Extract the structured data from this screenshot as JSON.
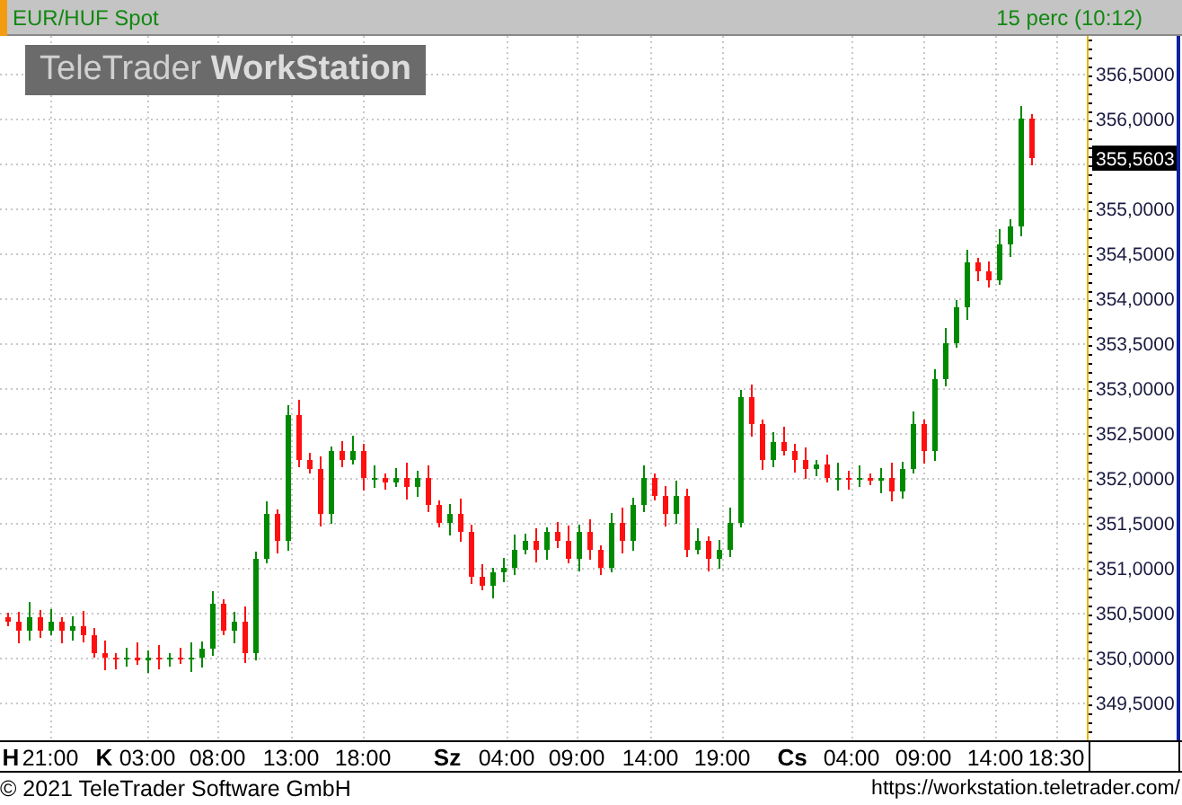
{
  "header": {
    "title": "EUR/HUF Spot",
    "interval": "15 perc (10:12)"
  },
  "logo": "TeleTrader **WorkStation**",
  "chart": {
    "last_price": "355,5603",
    "time_axis": [
      {
        "kind": "day",
        "label": "H"
      },
      {
        "kind": "time",
        "label": "21:00"
      },
      {
        "kind": "day",
        "label": "K"
      },
      {
        "kind": "time",
        "label": "03:00"
      },
      {
        "kind": "time",
        "label": "08:00"
      },
      {
        "kind": "time",
        "label": "13:00"
      },
      {
        "kind": "time",
        "label": "18:00"
      },
      {
        "kind": "day",
        "label": "Sz"
      },
      {
        "kind": "time",
        "label": "04:00"
      },
      {
        "kind": "time",
        "label": "09:00"
      },
      {
        "kind": "time",
        "label": "14:00"
      },
      {
        "kind": "time",
        "label": "19:00"
      },
      {
        "kind": "day",
        "label": "Cs"
      },
      {
        "kind": "time",
        "label": "04:00"
      },
      {
        "kind": "time",
        "label": "09:00"
      },
      {
        "kind": "time",
        "label": "14:00"
      },
      {
        "kind": "time",
        "label": "18:30"
      }
    ],
    "price_axis": [
      "356,5000",
      "356,0000",
      "355,0000",
      "354,5000",
      "354,0000",
      "353,5000",
      "353,0000",
      "352,5000",
      "352,0000",
      "351,5000",
      "351,0000",
      "350,5000",
      "350,0000",
      "349,5000"
    ]
  },
  "footer": {
    "copyright": "© 2021 TeleTrader Software GmbH",
    "url": "https://workstation.teletrader.com/"
  }
}
